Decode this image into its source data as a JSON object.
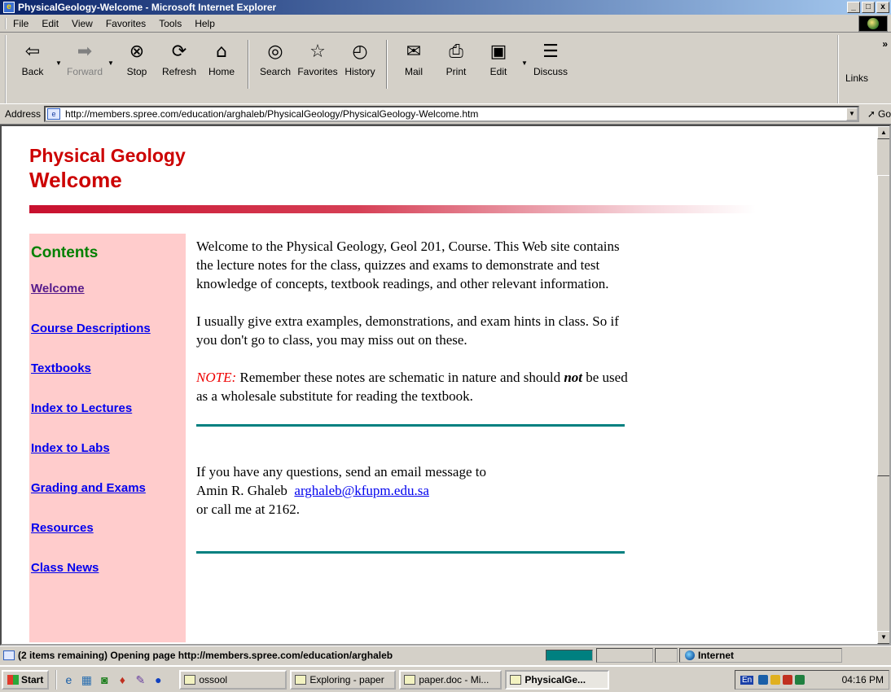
{
  "window": {
    "title": "PhysicalGeology-Welcome - Microsoft Internet Explorer",
    "controls": [
      "_",
      "□",
      "x"
    ]
  },
  "menu": [
    "File",
    "Edit",
    "View",
    "Favorites",
    "Tools",
    "Help"
  ],
  "toolbar": {
    "back": "Back",
    "forward": "Forward",
    "stop": "Stop",
    "refresh": "Refresh",
    "home": "Home",
    "search": "Search",
    "favorites": "Favorites",
    "history": "History",
    "mail": "Mail",
    "print": "Print",
    "edit": "Edit",
    "discuss": "Discuss",
    "links": "Links"
  },
  "address": {
    "label": "Address",
    "url": "http://members.spree.com/education/arghaleb/PhysicalGeology/PhysicalGeology-Welcome.htm",
    "go": "Go"
  },
  "page": {
    "course_title": "Physical Geology",
    "heading": "Welcome",
    "sidebar": {
      "title": "Contents",
      "links": [
        {
          "label": "Welcome",
          "visited": true
        },
        {
          "label": "Course Descriptions",
          "visited": false
        },
        {
          "label": "Textbooks",
          "visited": false
        },
        {
          "label": "Index to Lectures",
          "visited": false
        },
        {
          "label": "Index to Labs",
          "visited": false
        },
        {
          "label": "Grading and Exams",
          "visited": false
        },
        {
          "label": "Resources",
          "visited": false
        },
        {
          "label": "Class News",
          "visited": false
        }
      ]
    },
    "intro": "Welcome to the Physical Geology, Geol 201, Course. This Web site contains the lecture notes for the class, quizzes and exams to demonstrate and test knowledge of concepts, textbook readings, and other relevant information.",
    "extras": "I usually give extra examples, demonstrations, and exam hints in class. So if you don't go to class, you may miss out on these.",
    "note_label": "NOTE:",
    "note_part1": " Remember these notes are schematic in nature and should ",
    "note_not": "not",
    "note_part2": " be used as a wholesale substitute for reading the textbook.",
    "contact_line": "If you have any questions, send an email message to",
    "contact_name": "Amin R. Ghaleb",
    "contact_email": "arghaleb@kfupm.edu.sa",
    "contact_phone": "or call me at 2162."
  },
  "status": {
    "text": "(2 items remaining) Opening page http://members.spree.com/education/arghaleb",
    "zone": "Internet"
  },
  "taskbar": {
    "start": "Start",
    "tasks": [
      {
        "label": "ossool",
        "active": false
      },
      {
        "label": "Exploring - paper",
        "active": false
      },
      {
        "label": "paper.doc - Mi...",
        "active": false
      },
      {
        "label": "PhysicalGe...",
        "active": true
      }
    ],
    "lang": "En",
    "clock": "04:16 PM"
  },
  "colors": {
    "heading_red": "#cc0000",
    "sidebar_bg": "#ffcccc",
    "contents_green": "#008000",
    "link_blue": "#0000ee",
    "visited_purple": "#551a8b",
    "rule_teal": "#008080"
  }
}
